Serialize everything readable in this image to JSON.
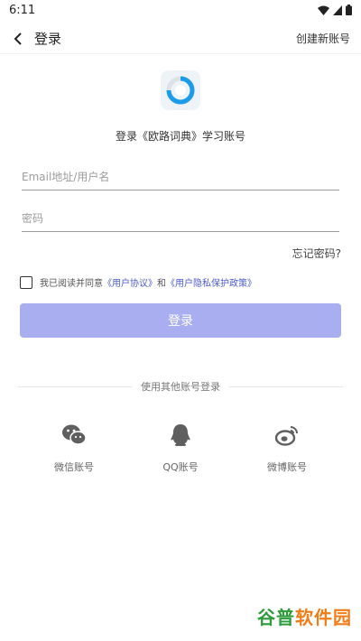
{
  "status_bar": {
    "time": "6:11"
  },
  "header": {
    "title": "登录",
    "create_account": "创建新账号"
  },
  "subtitle": "登录《欧路词典》学习账号",
  "form": {
    "email_placeholder": "Email地址/用户名",
    "password_placeholder": "密码",
    "forgot": "忘记密码?"
  },
  "agreement": {
    "prefix": "我已阅读并同意",
    "user_agreement": "《用户协议》",
    "and": "和",
    "privacy_policy": "《用户隐私保护政策》"
  },
  "login_button": "登录",
  "other_login": {
    "divider": "使用其他账号登录",
    "wechat": "微信账号",
    "qq": "QQ账号",
    "weibo": "微博账号"
  },
  "watermark": {
    "part1": "谷普",
    "part2": "软件园"
  },
  "colors": {
    "primary_button": "#a9aef0",
    "link": "#4a5bd0"
  }
}
